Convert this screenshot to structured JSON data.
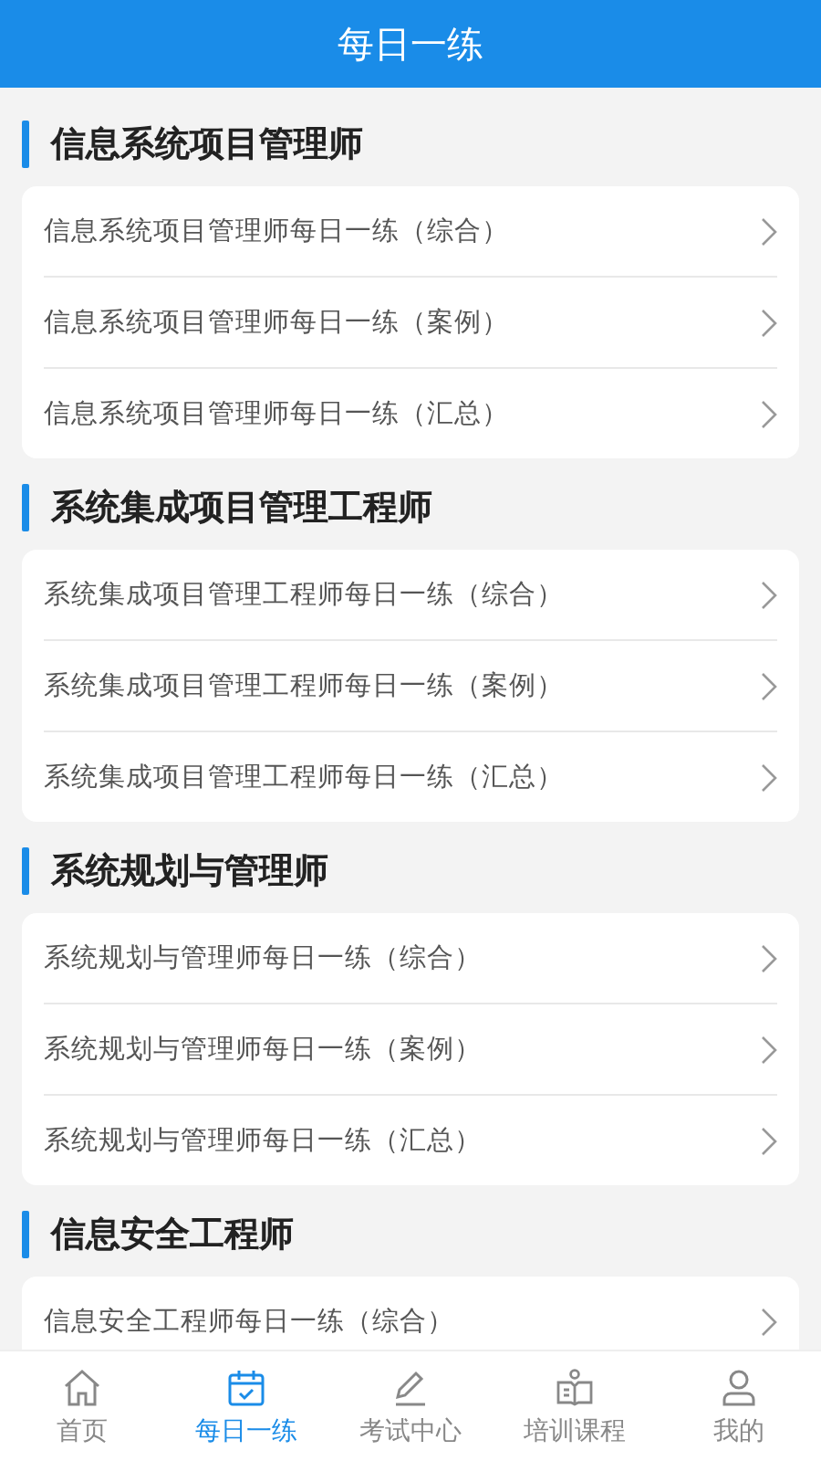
{
  "header": {
    "title": "每日一练"
  },
  "sections": [
    {
      "title": "信息系统项目管理师",
      "items": [
        "信息系统项目管理师每日一练（综合）",
        "信息系统项目管理师每日一练（案例）",
        "信息系统项目管理师每日一练（汇总）"
      ]
    },
    {
      "title": "系统集成项目管理工程师",
      "items": [
        "系统集成项目管理工程师每日一练（综合）",
        "系统集成项目管理工程师每日一练（案例）",
        "系统集成项目管理工程师每日一练（汇总）"
      ]
    },
    {
      "title": "系统规划与管理师",
      "items": [
        "系统规划与管理师每日一练（综合）",
        "系统规划与管理师每日一练（案例）",
        "系统规划与管理师每日一练（汇总）"
      ]
    },
    {
      "title": "信息安全工程师",
      "items": [
        "信息安全工程师每日一练（综合）"
      ]
    }
  ],
  "tab_bar": [
    {
      "kind": "home",
      "label": "首页",
      "selected": false
    },
    {
      "kind": "calendar",
      "label": "每日一练",
      "selected": true
    },
    {
      "kind": "pen",
      "label": "考试中心",
      "selected": false
    },
    {
      "kind": "book",
      "label": "培训课程",
      "selected": false
    },
    {
      "kind": "person",
      "label": "我的",
      "selected": false
    }
  ]
}
